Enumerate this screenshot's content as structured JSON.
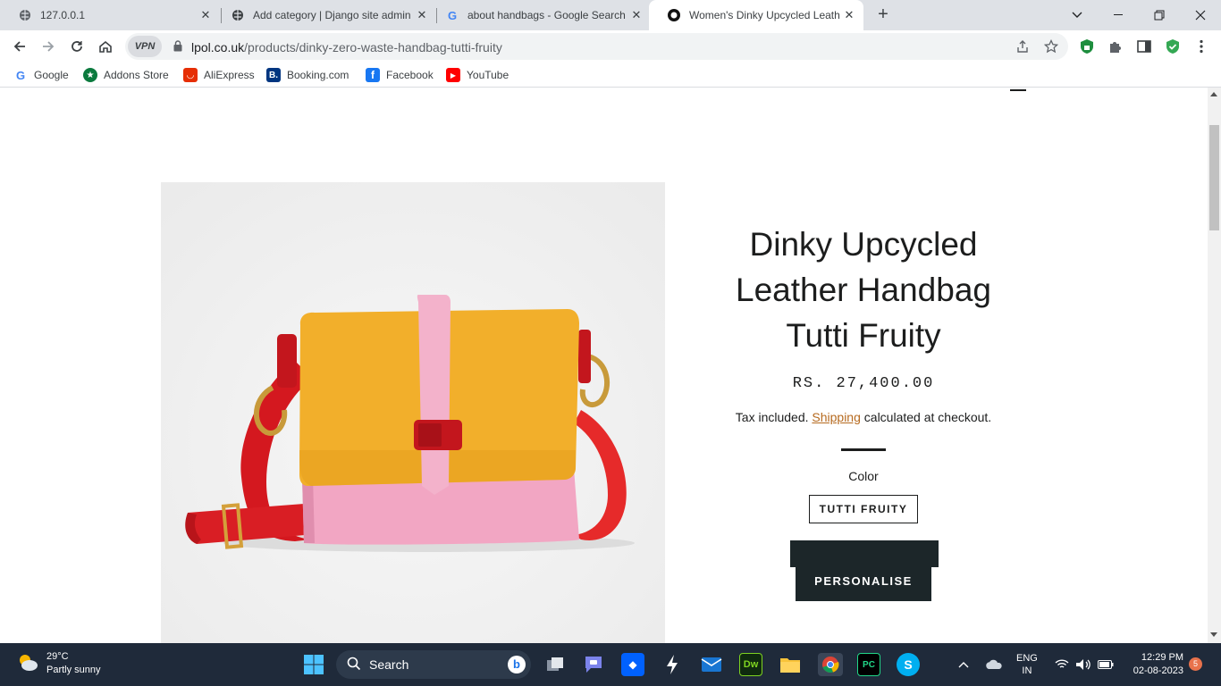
{
  "tabs": [
    {
      "title": "127.0.0.1",
      "active": false
    },
    {
      "title": "Add category | Django site admin",
      "active": false
    },
    {
      "title": "about handbags - Google Search",
      "active": false
    },
    {
      "title": "Women's Dinky Upcycled Leather",
      "active": true
    }
  ],
  "address": {
    "vpn": "VPN",
    "domain": "lpol.co.uk",
    "path": "/products/dinky-zero-waste-handbag-tutti-fruity"
  },
  "bookmarks": [
    "Google",
    "Addons Store",
    "AliExpress",
    "Booking.com",
    "Facebook",
    "YouTube"
  ],
  "product": {
    "title_line1": "Dinky Upcycled",
    "title_line2": "Leather Handbag",
    "title_line3": "Tutti Fruity",
    "price": "RS. 27,400.00",
    "tax_prefix": "Tax included.",
    "shipping_link": "Shipping",
    "tax_suffix": "calculated at checkout.",
    "color_label": "Color",
    "color_value": "TUTTI FRUITY",
    "personalise_label": "PERSONALISE"
  },
  "taskbar": {
    "temperature": "29°C",
    "weather": "Partly sunny",
    "search_label": "Search",
    "language_1": "ENG",
    "language_2": "IN",
    "time": "12:29 PM",
    "date": "02-08-2023",
    "notifications": "5"
  },
  "colors": {
    "tab_strip": "#dee1e6",
    "shipping_link": "#b66a1f",
    "dark_button": "#1c2629",
    "taskbar": "#1f2a3a"
  }
}
